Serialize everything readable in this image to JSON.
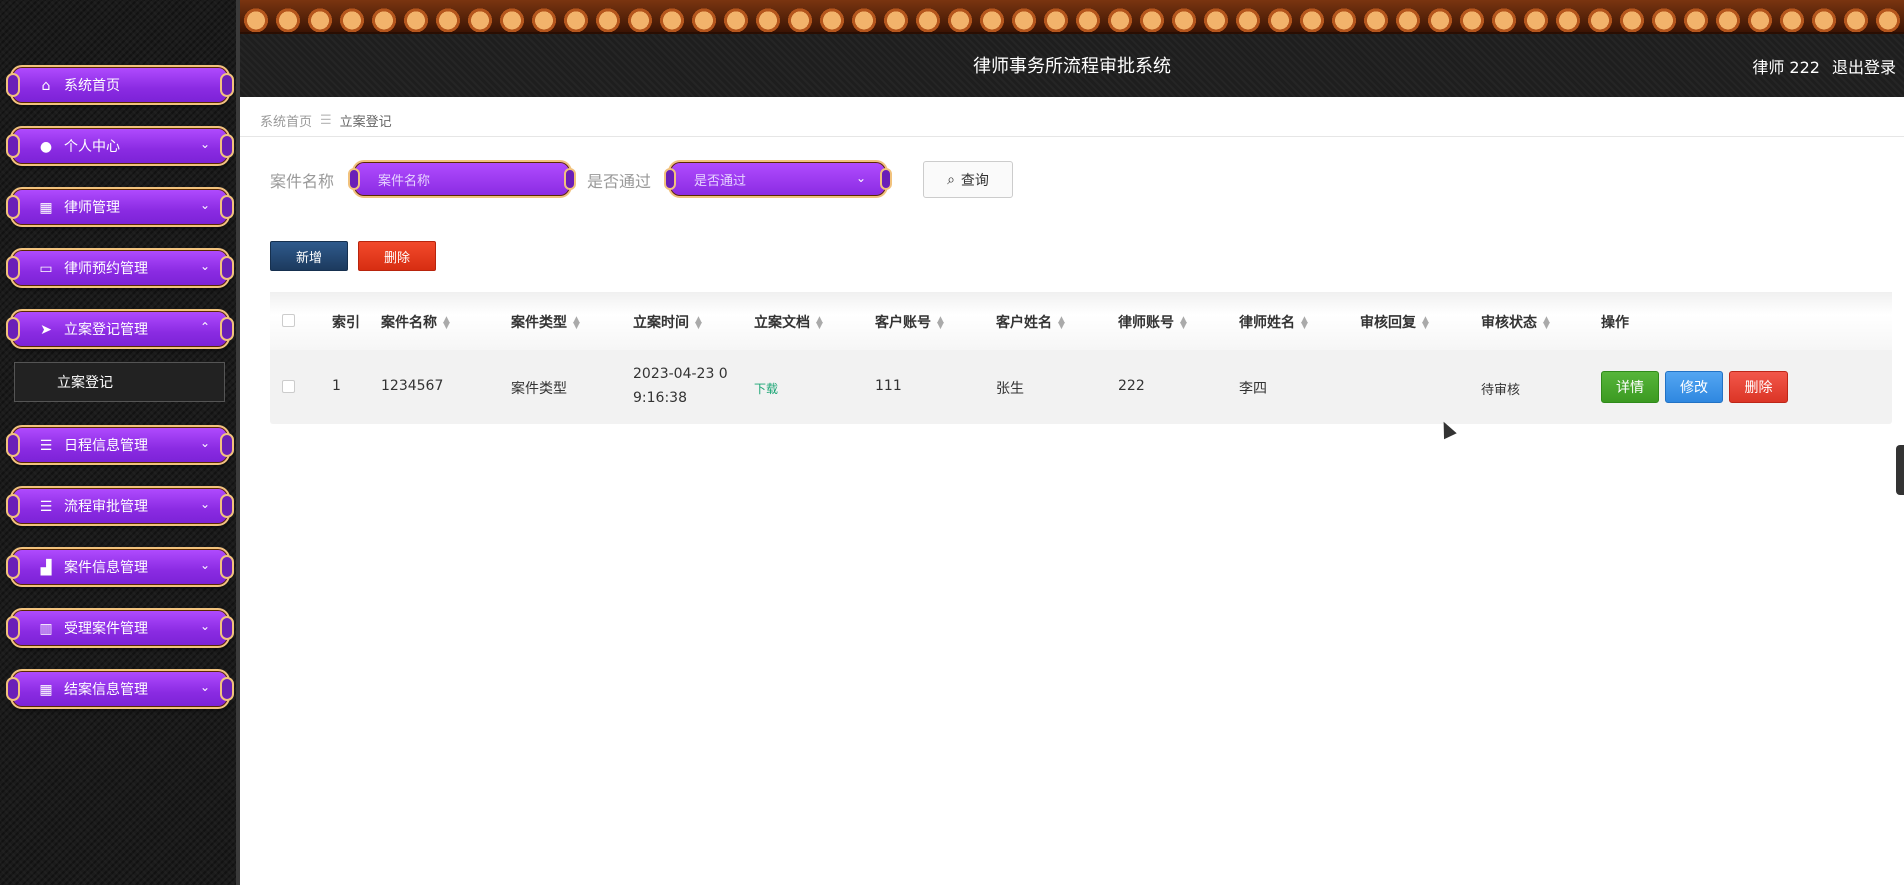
{
  "header": {
    "title": "律师事务所流程审批系统",
    "user": "律师 222",
    "logout": "退出登录"
  },
  "sidebar": {
    "items": [
      {
        "label": "系统首页",
        "icon": "home-icon",
        "glyph": "⌂",
        "chevron": ""
      },
      {
        "label": "个人中心",
        "icon": "user-icon",
        "glyph": "●",
        "chevron": "⌄"
      },
      {
        "label": "律师管理",
        "icon": "grid-icon",
        "glyph": "▦",
        "chevron": "⌄"
      },
      {
        "label": "律师预约管理",
        "icon": "monitor-icon",
        "glyph": "▭",
        "chevron": "⌄"
      },
      {
        "label": "立案登记管理",
        "icon": "send-icon",
        "glyph": "➤",
        "chevron": "⌃"
      },
      {
        "label": "日程信息管理",
        "icon": "list-icon",
        "glyph": "☰",
        "chevron": "⌄"
      },
      {
        "label": "流程审批管理",
        "icon": "list-icon",
        "glyph": "☰",
        "chevron": "⌄"
      },
      {
        "label": "案件信息管理",
        "icon": "thumb-icon",
        "glyph": "▟",
        "chevron": "⌄"
      },
      {
        "label": "受理案件管理",
        "icon": "building-icon",
        "glyph": "▥",
        "chevron": "⌄"
      },
      {
        "label": "结案信息管理",
        "icon": "grid-icon",
        "glyph": "▦",
        "chevron": "⌄"
      }
    ],
    "submenu": {
      "label": "立案登记"
    }
  },
  "breadcrumb": {
    "home": "系统首页",
    "sep": "☰",
    "current": "立案登记"
  },
  "search": {
    "case_name_label": "案件名称",
    "case_name_placeholder": "案件名称",
    "pass_label": "是否通过",
    "pass_placeholder": "是否通过",
    "query": "查询"
  },
  "actions": {
    "add": "新增",
    "delete": "删除"
  },
  "table": {
    "columns": [
      "索引",
      "案件名称",
      "案件类型",
      "立案时间",
      "立案文档",
      "客户账号",
      "客户姓名",
      "律师账号",
      "律师姓名",
      "审核回复",
      "审核状态",
      "操作"
    ],
    "rows": [
      {
        "index": "1",
        "case_name": "1234567",
        "case_type": "案件类型",
        "time_line1": "2023-04-23 0",
        "time_line2": "9:16:38",
        "doc": "下载",
        "client_account": "111",
        "client_name": "张生",
        "lawyer_account": "222",
        "lawyer_name": "李四",
        "reply": "",
        "status": "待审核",
        "op_detail": "详情",
        "op_edit": "修改",
        "op_delete": "删除"
      }
    ]
  },
  "colors": {
    "menu": "#8a2be2",
    "menu_border": "#f1c27d",
    "add": "#1c3a5e",
    "delete": "#d72e12",
    "detail": "#3c9a22",
    "edit": "#2f88e0"
  }
}
